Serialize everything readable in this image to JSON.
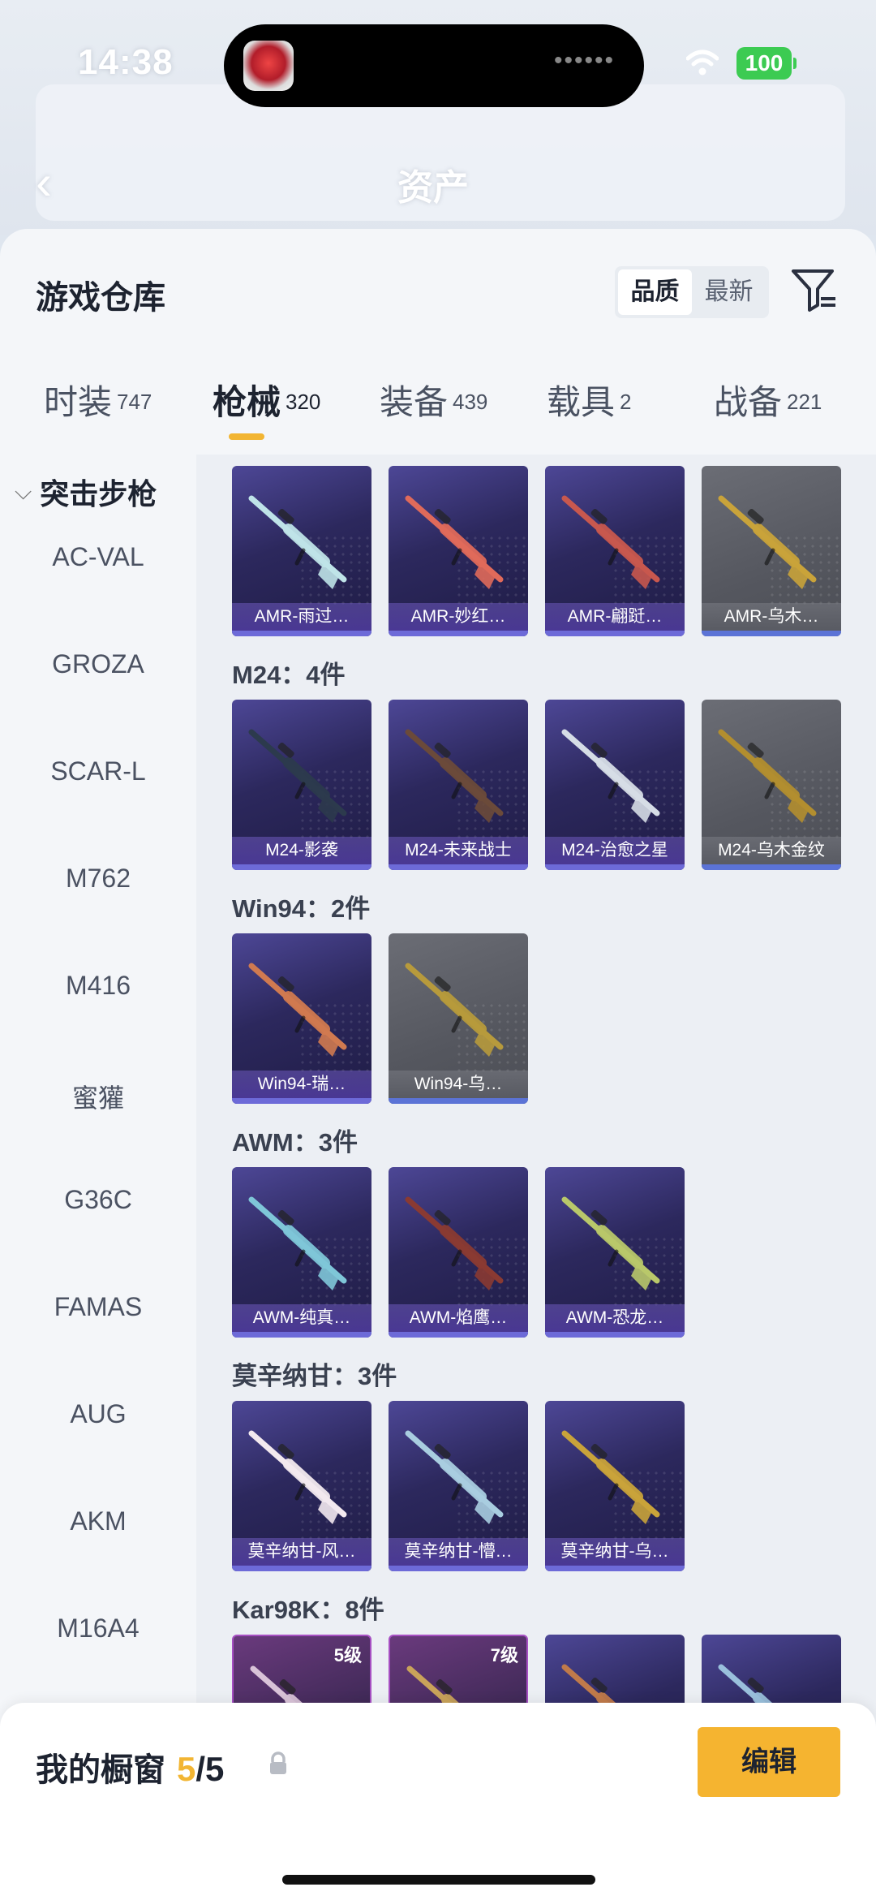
{
  "status_bar": {
    "time": "14:38",
    "battery": "100"
  },
  "background_page": {
    "title": "资产"
  },
  "sheet": {
    "title": "游戏仓库",
    "sort_options": [
      {
        "label": "品质",
        "active": true
      },
      {
        "label": "最新",
        "active": false
      }
    ]
  },
  "tabs": [
    {
      "label": "时装",
      "count": "747"
    },
    {
      "label": "枪械",
      "count": "320",
      "active": true
    },
    {
      "label": "装备",
      "count": "439"
    },
    {
      "label": "载具",
      "count": "2"
    },
    {
      "label": "战备",
      "count": "221"
    }
  ],
  "categories": {
    "header": "突击步枪",
    "items": [
      "AC-VAL",
      "GROZA",
      "SCAR-L",
      "M762",
      "M416",
      "蜜獾",
      "G36C",
      "FAMAS",
      "AUG",
      "AKM",
      "M16A4"
    ]
  },
  "groups": [
    {
      "title": "",
      "items": [
        {
          "name": "AMR-雨过…",
          "style": "purple",
          "gun_color": "#bfe3e8"
        },
        {
          "name": "AMR-妙红…",
          "style": "purple",
          "gun_color": "#e06a5a"
        },
        {
          "name": "AMR-翩跹…",
          "style": "purple",
          "gun_color": "#c8584e"
        },
        {
          "name": "AMR-乌木…",
          "style": "gray",
          "gun_color": "#c9a33a"
        }
      ]
    },
    {
      "title": "M24：4件",
      "items": [
        {
          "name": "M24-影袭",
          "style": "purple",
          "gun_color": "#2c3a4d"
        },
        {
          "name": "M24-未来战士",
          "style": "purple",
          "gun_color": "#6b4a3a"
        },
        {
          "name": "M24-治愈之星",
          "style": "purple",
          "gun_color": "#d6dde6"
        },
        {
          "name": "M24-乌木金纹",
          "style": "gray",
          "gun_color": "#b28e2f"
        }
      ]
    },
    {
      "title": "Win94：2件",
      "items": [
        {
          "name": "Win94-瑞…",
          "style": "purple",
          "gun_color": "#d07a50"
        },
        {
          "name": "Win94-乌…",
          "style": "gray",
          "gun_color": "#b79a3c"
        }
      ]
    },
    {
      "title": "AWM：3件",
      "items": [
        {
          "name": "AWM-纯真…",
          "style": "purple",
          "gun_color": "#7fc6d8"
        },
        {
          "name": "AWM-焰鹰…",
          "style": "purple",
          "gun_color": "#8a3a32"
        },
        {
          "name": "AWM-恐龙…",
          "style": "purple",
          "gun_color": "#b9c86a"
        }
      ]
    },
    {
      "title": "莫辛纳甘：3件",
      "items": [
        {
          "name": "莫辛纳甘-风…",
          "style": "purple",
          "gun_color": "#f3e9ef"
        },
        {
          "name": "莫辛纳甘-懵…",
          "style": "purple",
          "gun_color": "#a9cde0"
        },
        {
          "name": "莫辛纳甘-乌…",
          "style": "purple",
          "gun_color": "#c9a33a"
        }
      ]
    },
    {
      "title": "Kar98K：8件",
      "items": [
        {
          "name": "",
          "style": "pink",
          "gun_color": "#d9c3d8",
          "level": "5级"
        },
        {
          "name": "",
          "style": "pink",
          "gun_color": "#c9a35a",
          "level": "7级"
        },
        {
          "name": "",
          "style": "purple",
          "gun_color": "#c07a4a"
        },
        {
          "name": "",
          "style": "purple",
          "gun_color": "#9ac0dc"
        }
      ]
    }
  ],
  "bottom_bar": {
    "label": "我的橱窗",
    "current": "5",
    "max": "/5",
    "edit_label": "编辑"
  },
  "colors": {
    "accent": "#f5b430",
    "card_purple": "#2c285d",
    "card_gray": "#55575f",
    "card_bar": "#6d6ad8"
  },
  "icons": [
    "wifi-icon",
    "back-icon",
    "filter-icon",
    "chevron-down-icon",
    "share-icon",
    "lock-icon"
  ]
}
